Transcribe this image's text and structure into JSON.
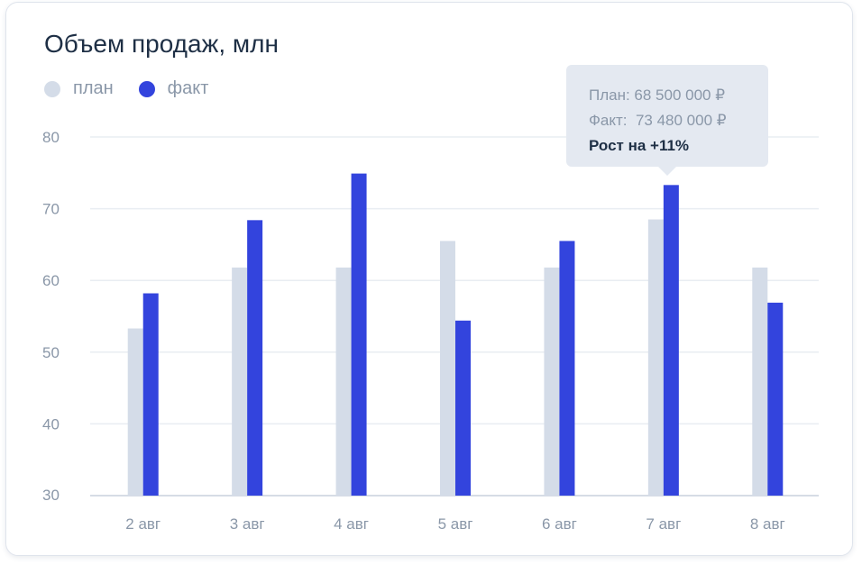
{
  "chart_data": {
    "type": "bar",
    "title": "Объем продаж, млн",
    "categories": [
      "2 авг",
      "3 авг",
      "4 авг",
      "5 авг",
      "6 авг",
      "7 авг",
      "8 авг"
    ],
    "series": [
      {
        "name": "план",
        "color": "#d4dce8",
        "values": [
          53.3,
          61.8,
          61.8,
          65.5,
          61.8,
          68.5,
          61.8
        ]
      },
      {
        "name": "факт",
        "color": "#3344dd",
        "values": [
          58.2,
          68.4,
          74.9,
          54.4,
          65.5,
          73.3,
          56.9
        ]
      }
    ],
    "y_ticks": [
      30,
      40,
      50,
      60,
      70,
      80
    ],
    "ylim": [
      30,
      80
    ],
    "grid": true,
    "legend_position": "top-left"
  },
  "tooltip": {
    "plan_line": "План: 68 500 000 ₽",
    "fact_line": "Факт:  73 480 000 ₽",
    "growth_line": "Рост на +11%",
    "category": "7 авг"
  }
}
